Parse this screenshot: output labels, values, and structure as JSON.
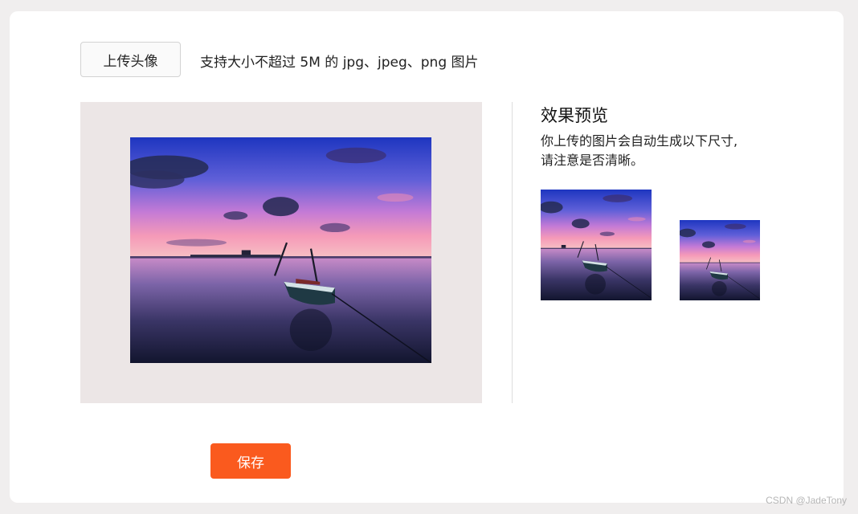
{
  "upload": {
    "button_label": "上传头像",
    "hint": "支持大小不超过 5M 的 jpg、jpeg、png 图片"
  },
  "preview": {
    "title": "效果预览",
    "desc_line1": "你上传的图片会自动生成以下尺寸,",
    "desc_line2": "请注意是否清晰。"
  },
  "actions": {
    "save_label": "保存"
  },
  "watermark": "CSDN @JadeTony",
  "colors": {
    "accent": "#fa5a1e",
    "crop_bg": "#ece6e6",
    "page_bg": "#f0eeee"
  }
}
